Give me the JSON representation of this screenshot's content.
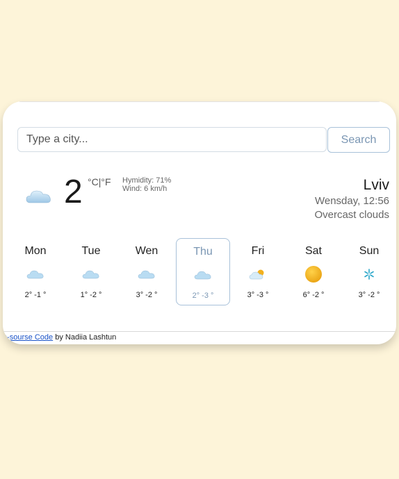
{
  "search": {
    "placeholder": "Type a city...",
    "button_label": "Search"
  },
  "current": {
    "temperature": "2",
    "unit_c": "°C",
    "unit_sep": "|",
    "unit_f": "°F",
    "humidity": "Hymidity: 71%",
    "wind": "Wind: 6 km/h",
    "icon": "cloud-icon",
    "city": "Lviv",
    "datetime": "Wensday, 12:56",
    "description": "Overcast clouds"
  },
  "forecast": [
    {
      "day": "Mon",
      "temps": "2° -1 °",
      "icon": "cloud-icon"
    },
    {
      "day": "Tue",
      "temps": "1° -2 °",
      "icon": "cloud-icon"
    },
    {
      "day": "Wen",
      "temps": "3° -2 °",
      "icon": "cloud-icon"
    },
    {
      "day": "Thu",
      "temps": "2° -3 °",
      "icon": "cloud-icon",
      "selected": true
    },
    {
      "day": "Fri",
      "temps": "3° -3 °",
      "icon": "cloud-sun-icon"
    },
    {
      "day": "Sat",
      "temps": "6° -2 °",
      "icon": "sun-icon"
    },
    {
      "day": "Sun",
      "temps": "3° -2 °",
      "icon": "snowflake-icon"
    }
  ],
  "footer": {
    "link_text": "n-sourse Code",
    "by_text": " by Nadiia Lashtun"
  },
  "colors": {
    "background": "#fdf4d9",
    "accent": "#7a96b3",
    "link": "#1a53c8",
    "sun": "#f2b01e",
    "snow": "#2aa6c9"
  }
}
